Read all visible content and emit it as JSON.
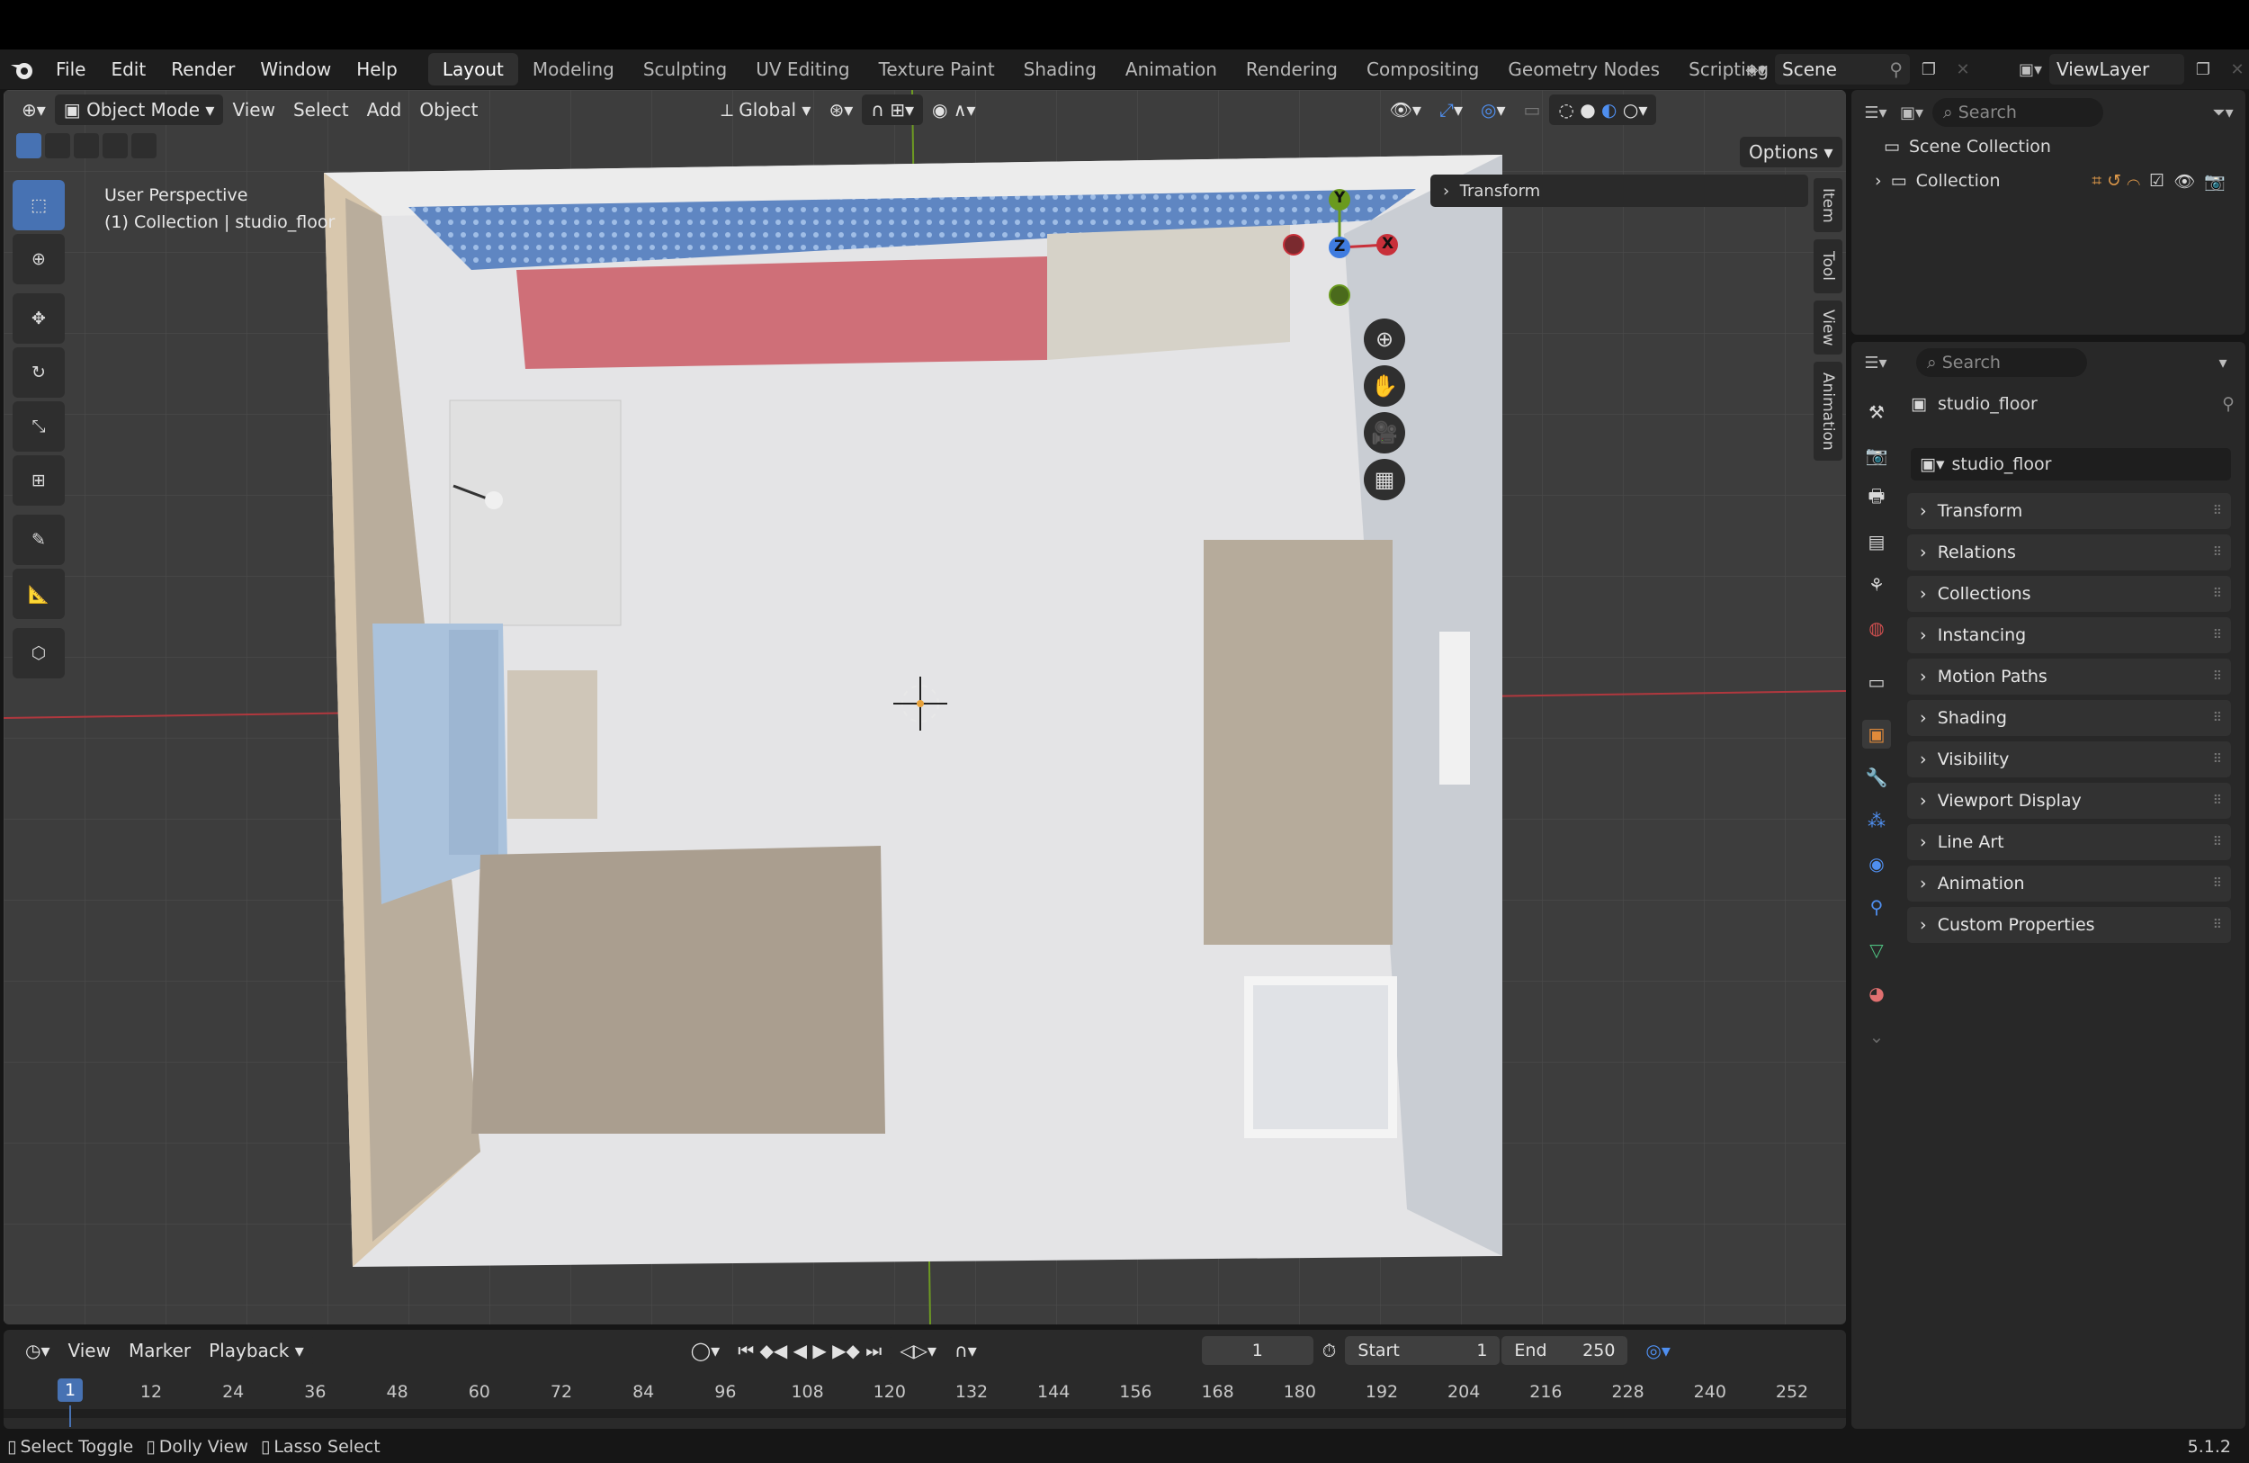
{
  "menubar": {
    "items": [
      "File",
      "Edit",
      "Render",
      "Window",
      "Help"
    ],
    "workspaces": [
      "Layout",
      "Modeling",
      "Sculpting",
      "UV Editing",
      "Texture Paint",
      "Shading",
      "Animation",
      "Rendering",
      "Compositing",
      "Geometry Nodes",
      "Scripting"
    ],
    "active_workspace": "Layout",
    "scene": "Scene",
    "view_layer": "ViewLayer"
  },
  "viewport": {
    "mode": "Object Mode",
    "menus": [
      "View",
      "Select",
      "Add",
      "Object"
    ],
    "orientation": "Global",
    "options_label": "Options",
    "perspective": "User Perspective",
    "context_line": "(1) Collection | studio_floor",
    "npanel_title": "Transform",
    "side_tabs": [
      "Item",
      "Tool",
      "View",
      "Animation"
    ],
    "gizmo": {
      "x": "X",
      "y": "Y",
      "z": "Z"
    }
  },
  "timeline": {
    "menus": [
      "View",
      "Marker",
      "Playback"
    ],
    "current_frame": "1",
    "start_label": "Start",
    "start": "1",
    "end_label": "End",
    "end": "250",
    "ticks": [
      "1",
      "12",
      "24",
      "36",
      "48",
      "60",
      "72",
      "84",
      "96",
      "108",
      "120",
      "132",
      "144",
      "156",
      "168",
      "180",
      "192",
      "204",
      "216",
      "228",
      "240",
      "252"
    ]
  },
  "outliner": {
    "search_placeholder": "Search",
    "scene_collection": "Scene Collection",
    "collection": "Collection"
  },
  "properties": {
    "search_placeholder": "Search",
    "object_name": "studio_floor",
    "panels": [
      "Transform",
      "Relations",
      "Collections",
      "Instancing",
      "Motion Paths",
      "Shading",
      "Visibility",
      "Viewport Display",
      "Line Art",
      "Animation",
      "Custom Properties"
    ]
  },
  "statusbar": {
    "hints": [
      "Select Toggle",
      "Dolly View",
      "Lasso Select"
    ],
    "version": "5.1.2"
  },
  "colors": {
    "accent": "#4772b3",
    "axis_x": "#c8303a",
    "axis_y": "#6a9a1e",
    "axis_z": "#3f7ce0"
  }
}
